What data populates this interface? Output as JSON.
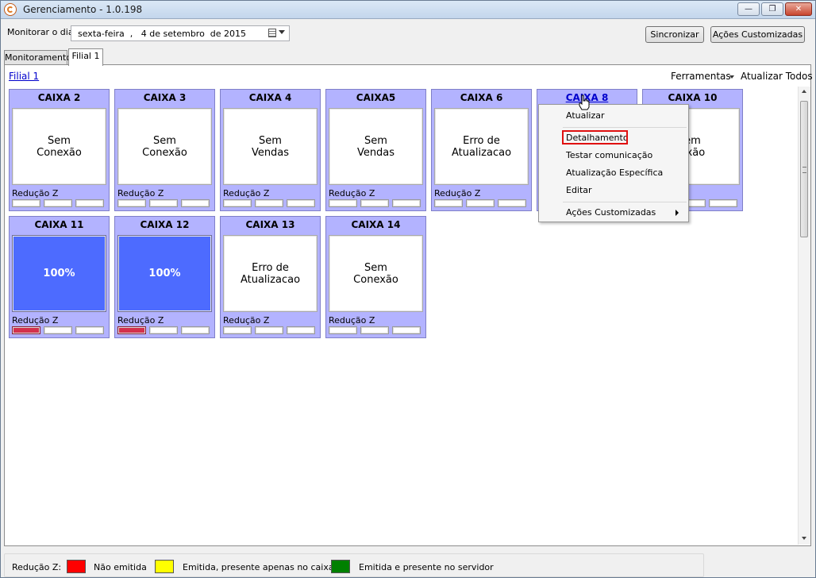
{
  "window": {
    "title": "Gerenciamento - 1.0.198",
    "min_glyph": "—",
    "max_glyph": "❐",
    "close_glyph": "✕"
  },
  "toolbar": {
    "monitor_label": "Monitorar o dia",
    "date_value": "sexta-feira  ,   4 de setembro  de 2015",
    "sync_button": "Sincronizar",
    "custom_actions_button": "Ações Customizadas"
  },
  "tabs": [
    {
      "label": "Monitoramento"
    },
    {
      "label": "Filial 1"
    }
  ],
  "panel": {
    "filial_link": "Filial 1",
    "tools_label": "Ferramentas",
    "refresh_all": "Atualizar Todos"
  },
  "caixas": [
    {
      "title": "CAIXA 2",
      "status_line1": "Sem",
      "status_line2": "Conexão",
      "footer": "Redução Z"
    },
    {
      "title": "CAIXA 3",
      "status_line1": "Sem",
      "status_line2": "Conexão",
      "footer": "Redução Z"
    },
    {
      "title": "CAIXA 4",
      "status_line1": "Sem",
      "status_line2": "Vendas",
      "footer": "Redução Z"
    },
    {
      "title": "CAIXA5",
      "status_line1": "Sem",
      "status_line2": "Vendas",
      "footer": "Redução Z"
    },
    {
      "title": "CAIXA 6",
      "status_line1": "Erro de",
      "status_line2": "Atualizacao",
      "footer": "Redução Z"
    },
    {
      "title": "CAIXA 8",
      "status_line1": "",
      "status_line2": "",
      "footer": ""
    },
    {
      "title": "CAIXA 10",
      "status_line1": "em",
      "status_line2": "exão",
      "footer": ""
    },
    {
      "title": "CAIXA 11",
      "status_line1": "100%",
      "status_line2": "",
      "footer": "Redução Z",
      "progress": 1.0
    },
    {
      "title": "CAIXA 12",
      "status_line1": "100%",
      "status_line2": "",
      "footer": "Redução Z",
      "progress": 1.0
    },
    {
      "title": "CAIXA 13",
      "status_line1": "Erro de",
      "status_line2": "Atualizacao",
      "footer": "Redução Z"
    },
    {
      "title": "CAIXA 14",
      "status_line1": "Sem",
      "status_line2": "Conexão",
      "footer": "Redução Z"
    }
  ],
  "context_menu": {
    "items": [
      {
        "label": "Atualizar"
      },
      {
        "label": "Detalhamento"
      },
      {
        "label": "Testar comunicação"
      },
      {
        "label": "Atualização Específica"
      },
      {
        "label": "Editar"
      },
      {
        "label": "Ações Customizadas"
      }
    ]
  },
  "legend": {
    "label": "Redução Z:",
    "entries": [
      {
        "text": "Não emitida",
        "color": "#ff0000"
      },
      {
        "text": "Emitida, presente apenas no caixa",
        "color": "#ffff00"
      },
      {
        "text": "Emitida e presente no servidor",
        "color": "#008000"
      }
    ]
  },
  "colors": {
    "caixa_header": "#b3b3ff",
    "progress_fill": "#4d6bff",
    "reducao_not_emitted": "#d3314c",
    "link": "#0000cc"
  }
}
